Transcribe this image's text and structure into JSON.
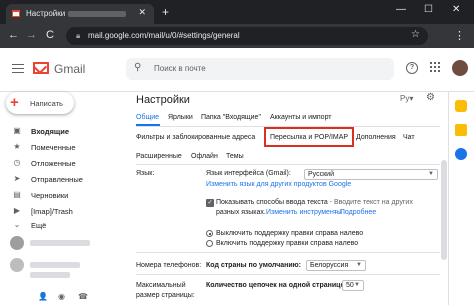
{
  "browser": {
    "tab_title": "Настройки",
    "tab_close": "✕",
    "new_tab": "+",
    "win_min": "—",
    "win_max": "☐",
    "win_close": "✕",
    "url": "mail.google.com/mail/u/0/#settings/general",
    "back": "←",
    "forward": "→",
    "reload": "C",
    "star": "☆",
    "menu": "⋮"
  },
  "header": {
    "brand": "Gmail",
    "search_placeholder": "Поиск в почте",
    "help": "?",
    "apps": "⋮⋮⋮"
  },
  "sidebar": {
    "compose_label": "Написать",
    "compose_icon": "+",
    "items": [
      {
        "icon": "▣",
        "label": "Входящие",
        "active": true
      },
      {
        "icon": "★",
        "label": "Помеченные"
      },
      {
        "icon": "◷",
        "label": "Отложенные"
      },
      {
        "icon": "➤",
        "label": "Отправленные"
      },
      {
        "icon": "▤",
        "label": "Черновики"
      },
      {
        "icon": "▶",
        "label": "[Imap]/Trash"
      },
      {
        "icon": "⌄",
        "label": "Ещё"
      }
    ],
    "footer_icons": [
      "👤",
      "◉",
      "☎"
    ]
  },
  "settings": {
    "title": "Настройки",
    "lang_short": "Ру",
    "lang_arrow": "▾",
    "gear": "⚙",
    "tabs_row1": [
      "Общие",
      "Ярлыки",
      "Папка \"Входящие\"",
      "Аккаунты и импорт"
    ],
    "tabs_row2": [
      "Фильтры и заблокированные адреса",
      "Пересылка и POP/IMAP",
      "Дополнения",
      "Чат"
    ],
    "tabs_row3": [
      "Расширенные",
      "Офлайн",
      "Темы"
    ],
    "language": {
      "label": "Язык:",
      "interface_label": "Язык интерфейса (Gmail):",
      "interface_value": "Русский",
      "change_link": "Изменить язык для других продуктов Google",
      "input_checkbox_text_1": "Показывать способы ввода текста",
      "input_checkbox_text_2": " - Вводите текст на других",
      "input_checkbox_text_3": "разных языках.",
      "input_tools_link": "Изменить инструменты",
      "more_link": " – Подробнее",
      "rtl_off": "Выключить поддержку правки справа налево",
      "rtl_on": "Включить поддержку правки справа налево"
    },
    "phone": {
      "label": "Номера телефонов:",
      "default_code_label": "Код страны по умолчанию:",
      "default_code_value": "Белоруссия"
    },
    "page_size": {
      "label_1": "Максимальный",
      "label_2": "размер страницы:",
      "threads_label": "Количество цепочек на одной странице:",
      "threads_value": "50"
    },
    "highlight_color": "#d93025"
  }
}
